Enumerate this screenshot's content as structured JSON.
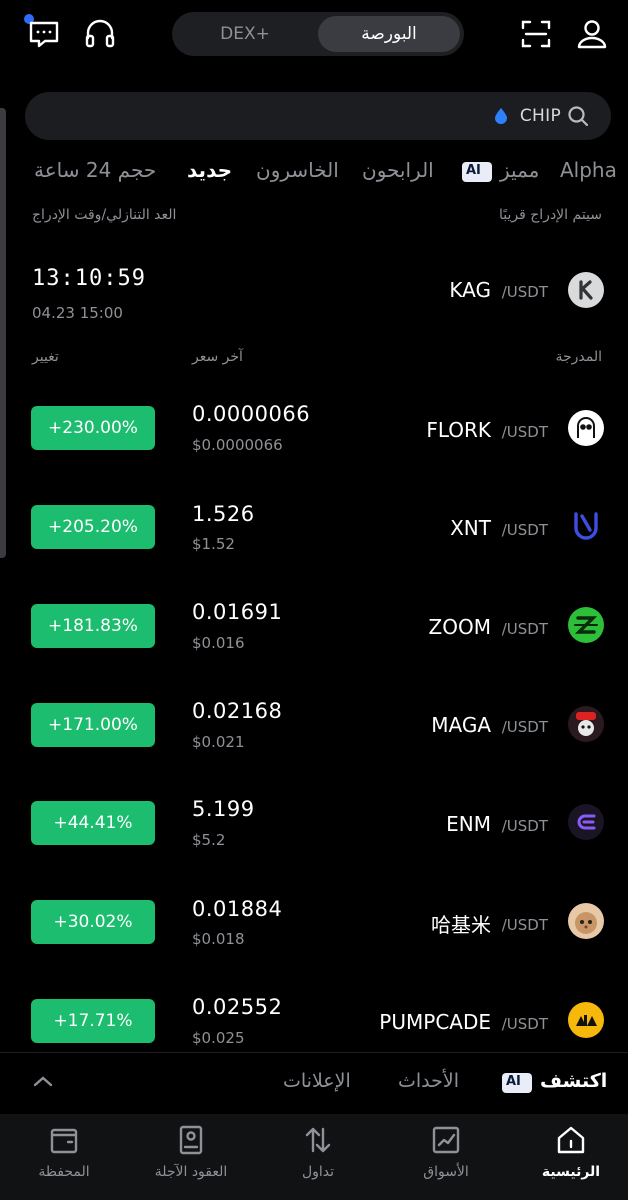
{
  "header": {
    "segment_dex": "DEX+",
    "segment_exchange": "البورصة"
  },
  "search": {
    "chip": "CHIP"
  },
  "tabs": [
    {
      "label": "Alpha"
    },
    {
      "label": "مميز"
    },
    {
      "label": "الرابحون"
    },
    {
      "label": "الخاسرون"
    },
    {
      "label": "جديد"
    },
    {
      "label": "حجم 24 ساعة"
    }
  ],
  "ai_badge": "AI",
  "upcoming": {
    "right_label": "سيتم الإدراج قريبًا",
    "left_label": "العد التنازلي/وقت الإدراج",
    "symbol": "KAG",
    "quote": " /USDT",
    "countdown": "13:10:59",
    "list_time": "04.23 15:00"
  },
  "columns": {
    "listed": "المدرجة",
    "last_price": "آخر سعر",
    "change": "تغيير"
  },
  "rows": [
    {
      "symbol": "FLORK",
      "quote": " /USDT",
      "price": "0.0000066",
      "usd": "$0.0000066",
      "change": "+230.00%"
    },
    {
      "symbol": "XNT",
      "quote": " /USDT",
      "price": "1.526",
      "usd": "$1.52",
      "change": "+205.20%"
    },
    {
      "symbol": "ZOOM",
      "quote": " /USDT",
      "price": "0.01691",
      "usd": "$0.016",
      "change": "+181.83%"
    },
    {
      "symbol": "MAGA",
      "quote": " /USDT",
      "price": "0.02168",
      "usd": "$0.021",
      "change": "+171.00%"
    },
    {
      "symbol": "ENM",
      "quote": " /USDT",
      "price": "5.199",
      "usd": "$5.2",
      "change": "+44.41%"
    },
    {
      "symbol": "哈基米",
      "quote": " /USDT",
      "price": "0.01884",
      "usd": "$0.018",
      "change": "+30.02%"
    },
    {
      "symbol": "PUMPCADE",
      "quote": " /USDT",
      "price": "0.02552",
      "usd": "$0.025",
      "change": "+17.71%"
    }
  ],
  "strip": {
    "explore": "اكتشف",
    "events": "الأحداث",
    "announcements": "الإعلانات"
  },
  "nav": [
    {
      "label": "الرئيسية"
    },
    {
      "label": "الأسواق"
    },
    {
      "label": "تداول"
    },
    {
      "label": "العقود الآجلة"
    },
    {
      "label": "المحفظة"
    }
  ],
  "colors": {
    "positive": "#1dbd6f",
    "background": "#000000",
    "muted": "#8e9196"
  }
}
